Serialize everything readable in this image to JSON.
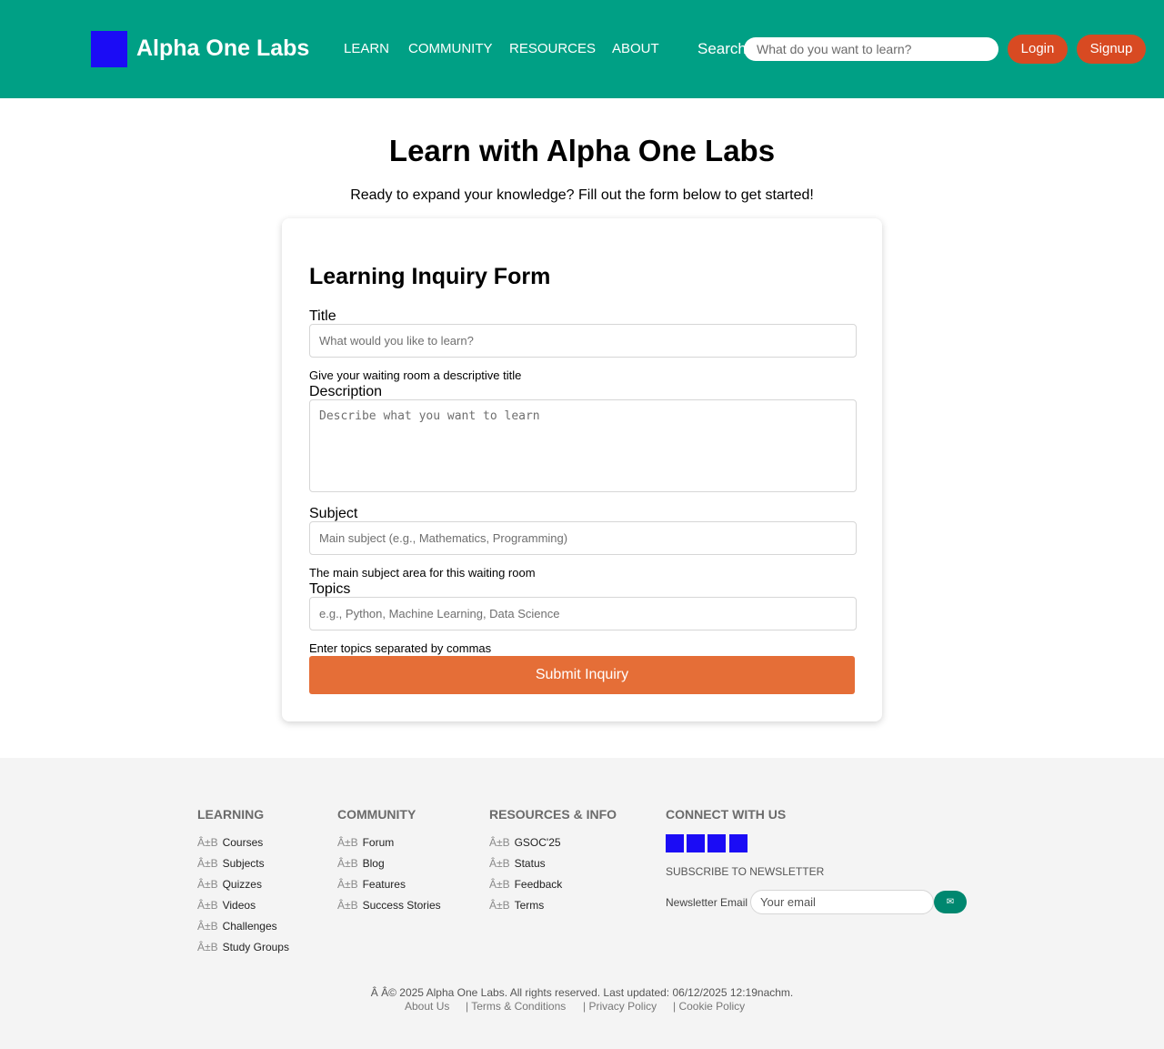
{
  "header": {
    "brand": "Alpha One Labs",
    "nav": [
      "LEARN",
      "COMMUNITY",
      "RESOURCES",
      "ABOUT"
    ],
    "search_label": "Search",
    "search_placeholder": "What do you want to learn?",
    "login_label": "Login",
    "signup_label": "Signup",
    "accent_color": "#00a085",
    "button_color": "#d84a22",
    "logo_color": "#1b0cf5"
  },
  "hero": {
    "title": "Learn with Alpha One Labs",
    "subtitle": "Ready to expand your knowledge? Fill out the form below to get started!"
  },
  "form": {
    "title": "Learning Inquiry Form",
    "fields": {
      "title": {
        "label": "Title",
        "placeholder": "What would you like to learn?",
        "help": "Give your waiting room a descriptive title"
      },
      "description": {
        "label": "Description",
        "placeholder": "Describe what you want to learn"
      },
      "subject": {
        "label": "Subject",
        "placeholder": "Main subject (e.g., Mathematics, Programming)",
        "help": "The main subject area for this waiting room"
      },
      "topics": {
        "label": "Topics",
        "placeholder": "e.g., Python, Machine Learning, Data Science",
        "help": "Enter topics separated by commas"
      }
    },
    "submit_label": "Submit Inquiry",
    "submit_color": "#e56e37"
  },
  "footer": {
    "bullet": "Â±B",
    "columns": [
      {
        "heading": "LEARNING",
        "items": [
          "Courses",
          "Subjects",
          "Quizzes",
          "Videos",
          "Challenges",
          "Study Groups"
        ]
      },
      {
        "heading": "COMMUNITY",
        "items": [
          "Forum",
          "Blog",
          "Features",
          "Success Stories"
        ]
      },
      {
        "heading": "RESOURCES & INFO",
        "items": [
          "GSOC'25",
          "Status",
          "Feedback",
          "Terms"
        ]
      }
    ],
    "connect": {
      "heading": "CONNECT WITH US",
      "social_icons": [
        "social-icon-1",
        "social-icon-2",
        "social-icon-3",
        "social-icon-4"
      ],
      "subscribe_label": "SUBSCRIBE TO NEWSLETTER",
      "email_label": "Newsletter Email",
      "email_placeholder": "Your email",
      "submit_glyph": "✉"
    },
    "copyright": "Â   Â© 2025 Alpha One Labs. All rights reserved. Last updated: 06/12/2025 12:19nachm.",
    "bottom_links": [
      "About Us",
      "| Terms & Conditions",
      "| Privacy Policy",
      "| Cookie Policy"
    ]
  }
}
